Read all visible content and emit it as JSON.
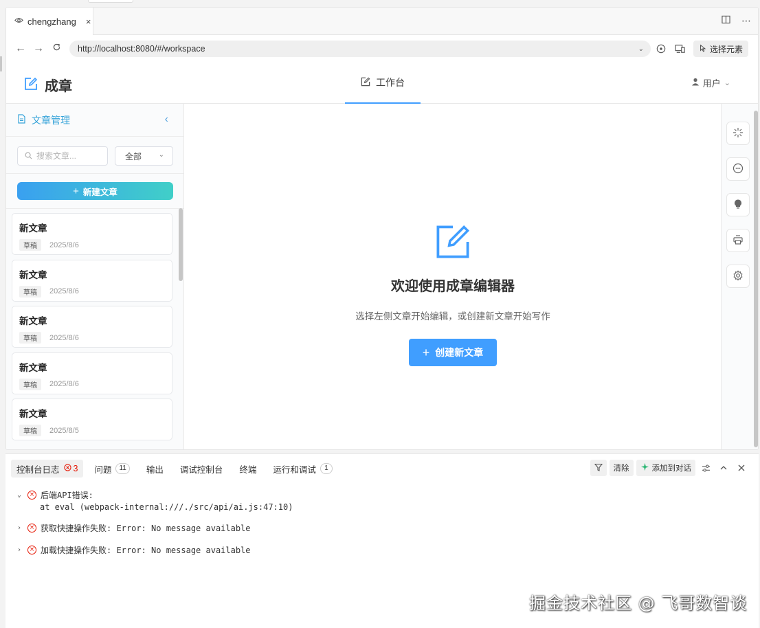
{
  "browser": {
    "tab_title": "chengzhang",
    "tab_close": "×",
    "url": "http://localhost:8080/#/workspace",
    "pick_element_label": "选择元素"
  },
  "app": {
    "brand": "成章",
    "nav_tab_label": "工作台",
    "user_label": "用户"
  },
  "sidebar": {
    "title": "文章管理",
    "search_placeholder": "搜索文章...",
    "filter_value": "全部",
    "new_button_label": "新建文章",
    "articles": [
      {
        "title": "新文章",
        "status": "草稿",
        "date": "2025/8/6"
      },
      {
        "title": "新文章",
        "status": "草稿",
        "date": "2025/8/6"
      },
      {
        "title": "新文章",
        "status": "草稿",
        "date": "2025/8/6"
      },
      {
        "title": "新文章",
        "status": "草稿",
        "date": "2025/8/6"
      },
      {
        "title": "新文章",
        "status": "草稿",
        "date": "2025/8/5"
      }
    ]
  },
  "main": {
    "welcome_title": "欢迎使用成章编辑器",
    "welcome_subtitle": "选择左侧文章开始编辑，或创建新文章开始写作",
    "create_button_label": "创建新文章"
  },
  "devtools": {
    "tabs": [
      {
        "label": "控制台日志",
        "count": "3",
        "kind": "error"
      },
      {
        "label": "问题",
        "count": "11",
        "kind": "badge"
      },
      {
        "label": "输出"
      },
      {
        "label": "调试控制台"
      },
      {
        "label": "终端"
      },
      {
        "label": "运行和调试",
        "count": "1",
        "kind": "badge"
      }
    ],
    "clear_label": "清除",
    "add_to_chat_label": "添加到对话",
    "logs": [
      {
        "text": "后端API错误:",
        "detail": "at eval (webpack-internal:///./src/api/ai.js:47:10)",
        "expanded": true
      },
      {
        "text": "获取快捷操作失败: Error: No message available",
        "expanded": false
      },
      {
        "text": "加载快捷操作失败: Error: No message available",
        "expanded": false
      }
    ]
  },
  "watermark": "掘金技术社区 @ 飞哥数智谈",
  "colors": {
    "accent": "#409eff",
    "gradient_start": "#3aa0f0",
    "gradient_end": "#40cfc8",
    "error": "#e51400"
  }
}
